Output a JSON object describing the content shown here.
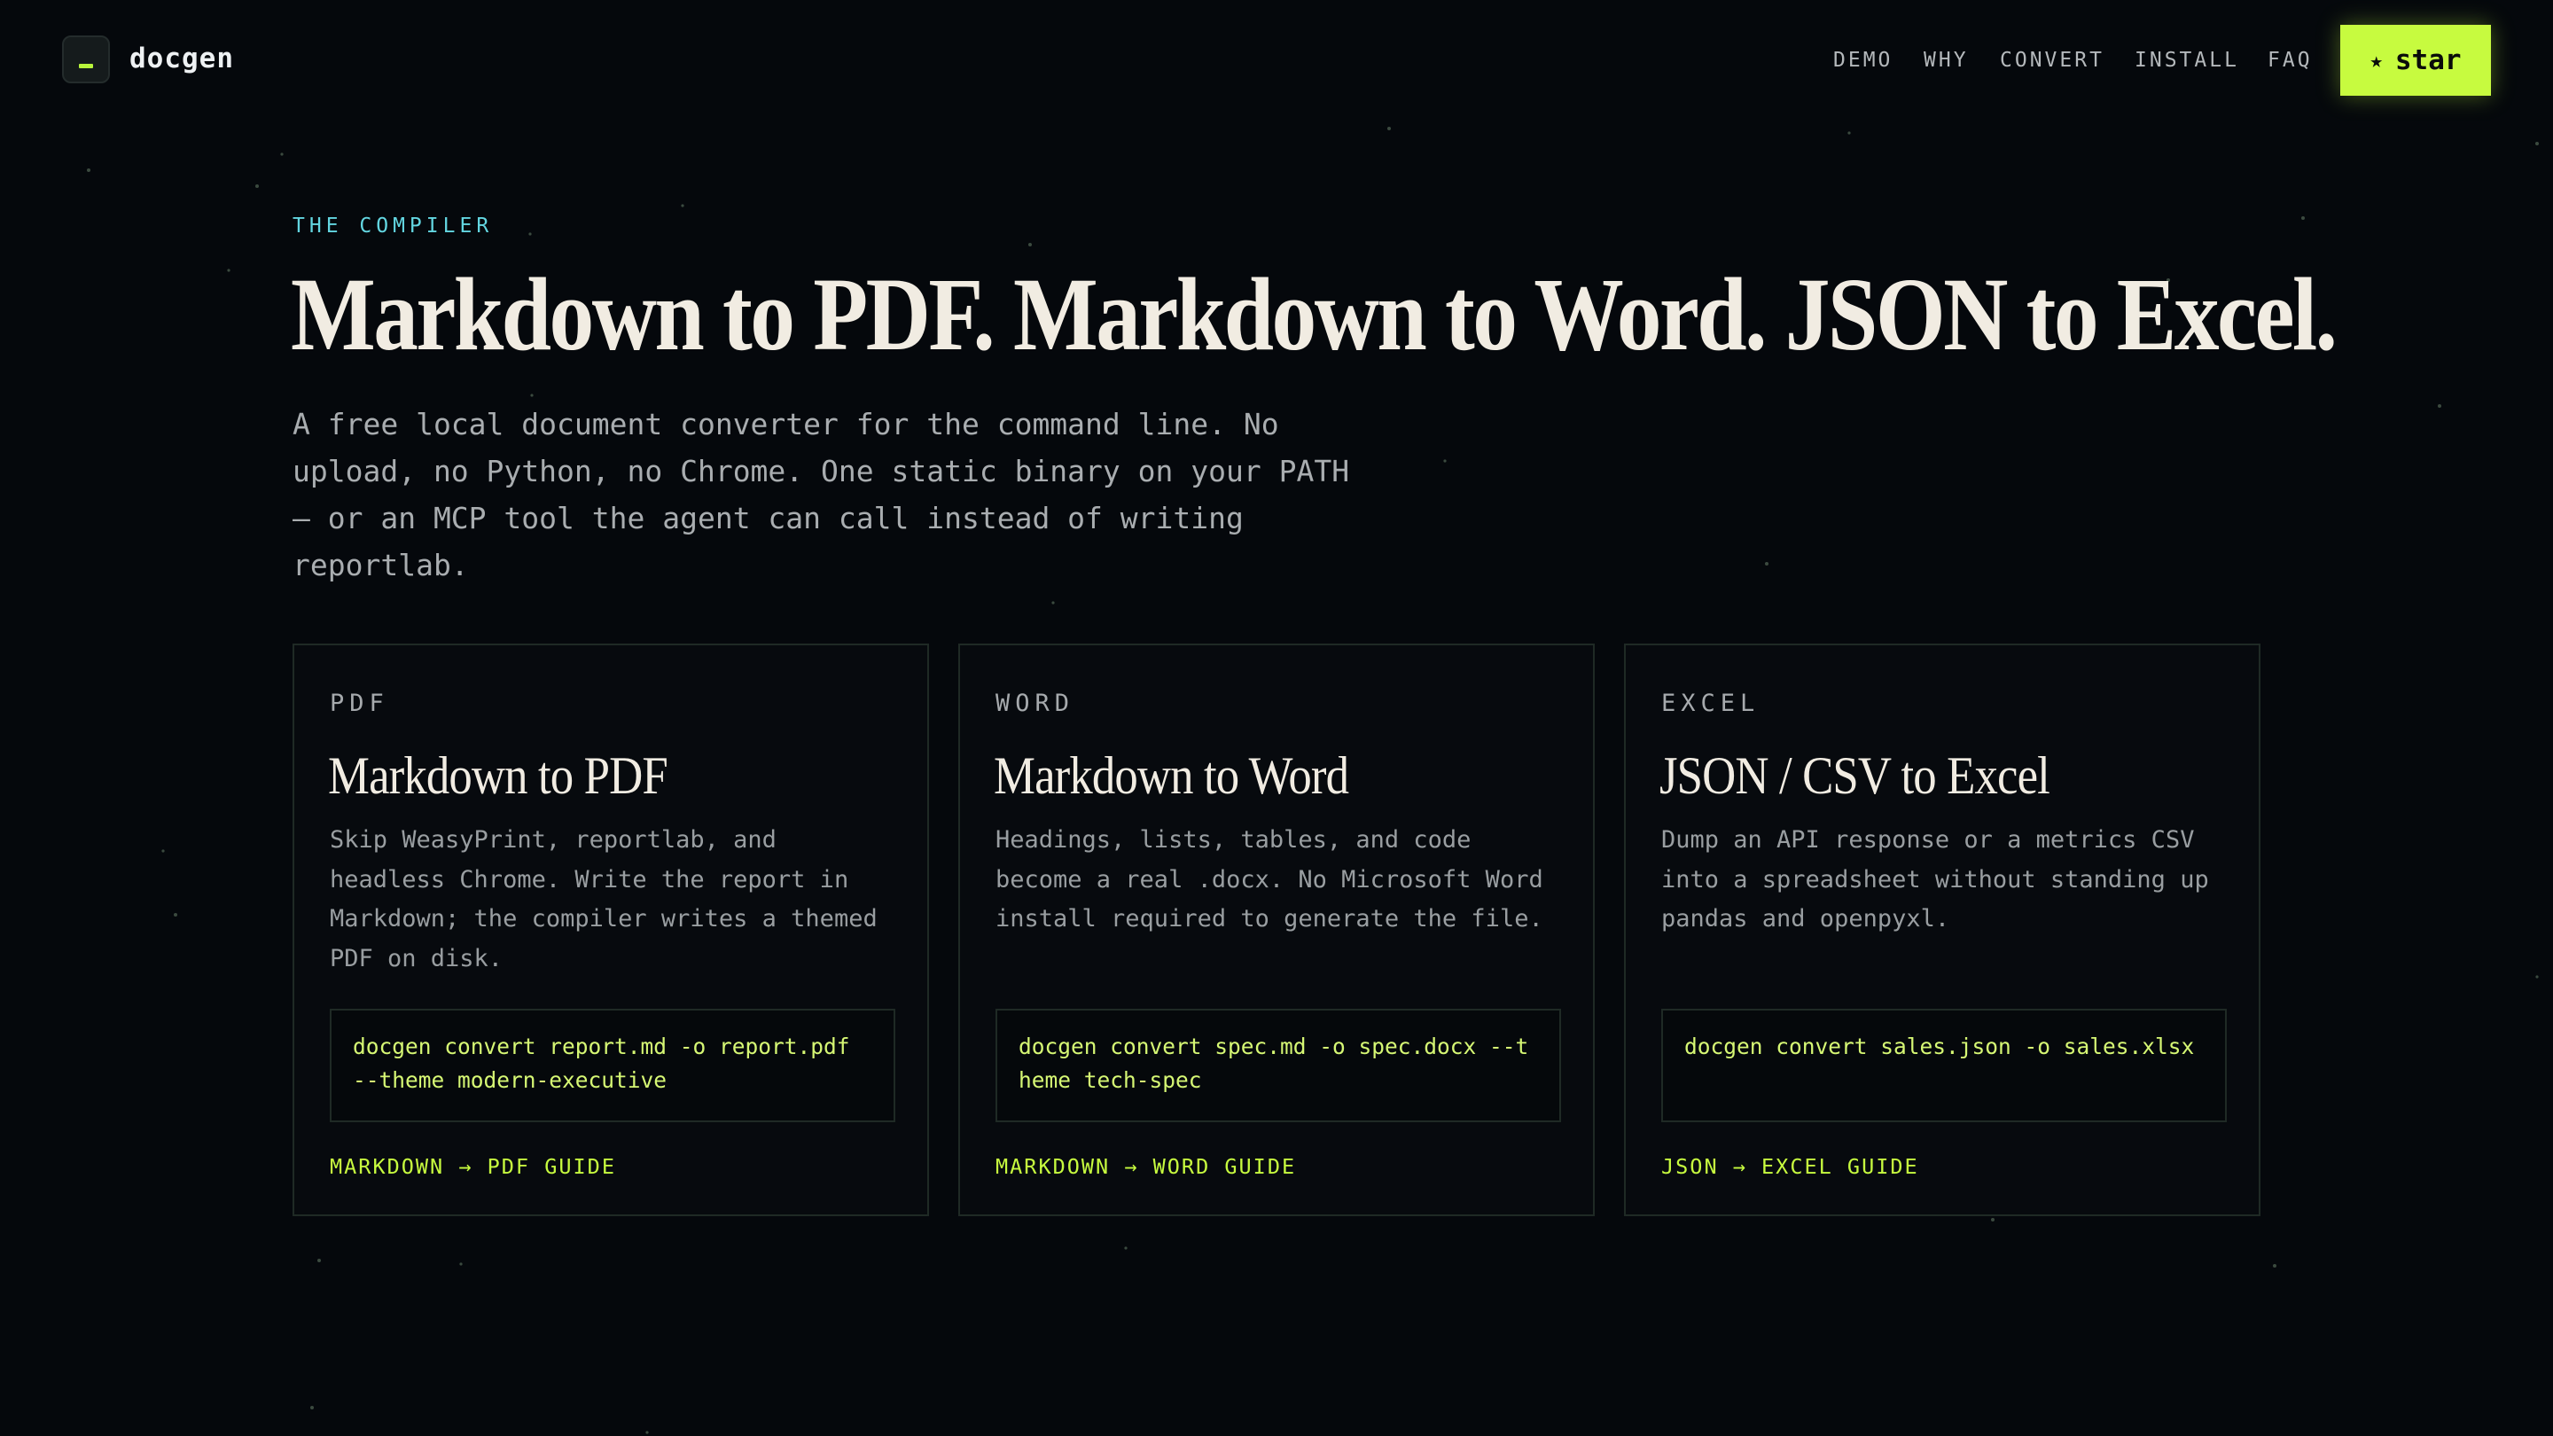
{
  "header": {
    "brand": "docgen",
    "nav": [
      {
        "label": "DEMO"
      },
      {
        "label": "WHY"
      },
      {
        "label": "CONVERT"
      },
      {
        "label": "INSTALL"
      },
      {
        "label": "FAQ"
      }
    ],
    "star_label": "star",
    "star_icon": "★"
  },
  "hero": {
    "eyebrow": "THE COMPILER",
    "headline": "Markdown to PDF. Markdown to Word. JSON to Excel.",
    "lede": "A free local document converter for the command line. No upload, no Python, no Chrome. One static binary on your PATH — or an MCP tool the agent can call instead of writing reportlab."
  },
  "cards": [
    {
      "kicker": "PDF",
      "title": "Markdown to PDF",
      "desc": "Skip WeasyPrint, reportlab, and headless Chrome. Write the report in Markdown; the compiler writes a themed PDF on disk.",
      "code": "docgen convert report.md -o report.pdf --theme modern-executive",
      "link": "MARKDOWN → PDF GUIDE"
    },
    {
      "kicker": "WORD",
      "title": "Markdown to Word",
      "desc": "Headings, lists, tables, and code become a real .docx. No Microsoft Word install required to generate the file.",
      "code": "docgen convert spec.md -o spec.docx --theme tech-spec",
      "link": "MARKDOWN → WORD GUIDE"
    },
    {
      "kicker": "EXCEL",
      "title": "JSON / CSV to Excel",
      "desc": "Dump an API response or a metrics CSV into a spreadsheet without standing up pandas and openpyxl.",
      "code": "docgen convert sales.json -o sales.xlsx",
      "link": "JSON → EXCEL GUIDE"
    }
  ],
  "colors": {
    "background": "#05080c",
    "accent": "#c7fb3f",
    "eyebrow": "#63d6e1",
    "headline": "#f1ece2"
  }
}
